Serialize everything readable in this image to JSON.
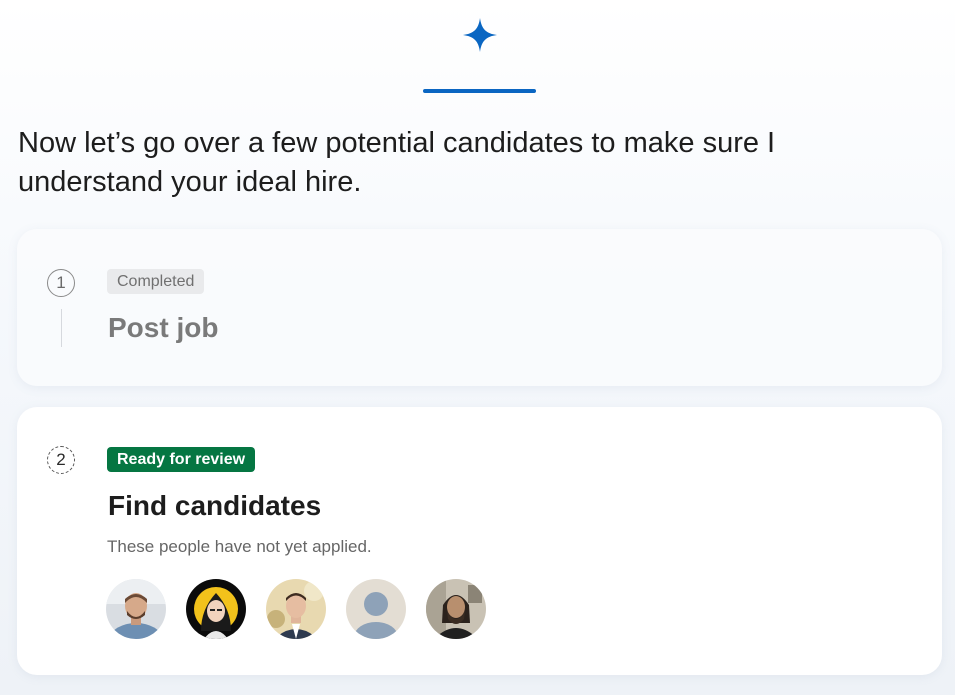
{
  "header": {
    "icon": "sparkle-icon",
    "accent_color": "#0a66c2",
    "message": "Now let’s go over a few potential candidates to make sure I understand your ideal hire."
  },
  "steps": [
    {
      "number": "1",
      "status": "Completed",
      "title": "Post job"
    },
    {
      "number": "2",
      "status": "Ready for review",
      "status_color": "#057642",
      "title": "Find candidates",
      "subtitle": "These people have not yet applied."
    }
  ],
  "avatars": [
    "avatar-photo",
    "avatar-photo",
    "avatar-photo",
    "default-avatar-icon",
    "avatar-photo"
  ]
}
